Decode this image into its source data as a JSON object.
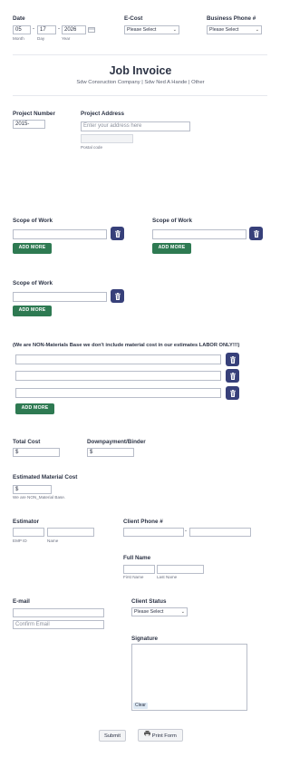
{
  "date": {
    "label": "Date",
    "month": "05",
    "day": "17",
    "year": "2026",
    "sep": "-",
    "month_label": "Month",
    "day_label": "Day",
    "year_label": "Year"
  },
  "ecost": {
    "label": "E-Cost",
    "selected": "Please Select"
  },
  "business_phone": {
    "label": "Business Phone #",
    "selected": "Please Select"
  },
  "header": {
    "title": "Job Invoice",
    "subtitle": "Sdw Consruction Company | Sdw Ned A Hande | Other"
  },
  "project_number": {
    "label": "Project Number",
    "value": "2015-"
  },
  "project_address": {
    "label": "Project Address",
    "placeholder": "Enter your address here",
    "postal_label": "Postal code"
  },
  "scope1": {
    "label": "Scope of Work",
    "add_label": "ADD MORE"
  },
  "scope2": {
    "label": "Scope of Work",
    "add_label": "ADD MORE"
  },
  "scope3": {
    "label": "Scope of Work",
    "add_label": "ADD MORE"
  },
  "materials": {
    "label": "(We are NON-Materials Base we don't include material cost in our estimates LABOR ONLY!!!)",
    "add_label": "ADD MORE"
  },
  "total_cost": {
    "label": "Total Cost",
    "prefix": "$"
  },
  "downpayment": {
    "label": "Downpayment/Binder",
    "prefix": "$"
  },
  "estimated_material": {
    "label": "Estimated Material Cost",
    "prefix": "$",
    "note": "We are NON_Material Base."
  },
  "estimator": {
    "label": "Estimator",
    "emp_label": "EMP ID",
    "name_label": "Name"
  },
  "client_phone": {
    "label": "Client Phone #",
    "sep": "-"
  },
  "full_name": {
    "label": "Full Name",
    "first_label": "First Name",
    "last_label": "Last Name"
  },
  "email": {
    "label": "E-mail",
    "confirm_placeholder": "Confirm Email"
  },
  "client_status": {
    "label": "Client Status",
    "selected": "Please Select"
  },
  "signature": {
    "label": "Signature",
    "clear_label": "Clear"
  },
  "actions": {
    "submit_label": "Submit",
    "print_label": "Print Form"
  },
  "colors": {
    "add_button": "#2e7a52",
    "trash_button": "#37407a"
  }
}
